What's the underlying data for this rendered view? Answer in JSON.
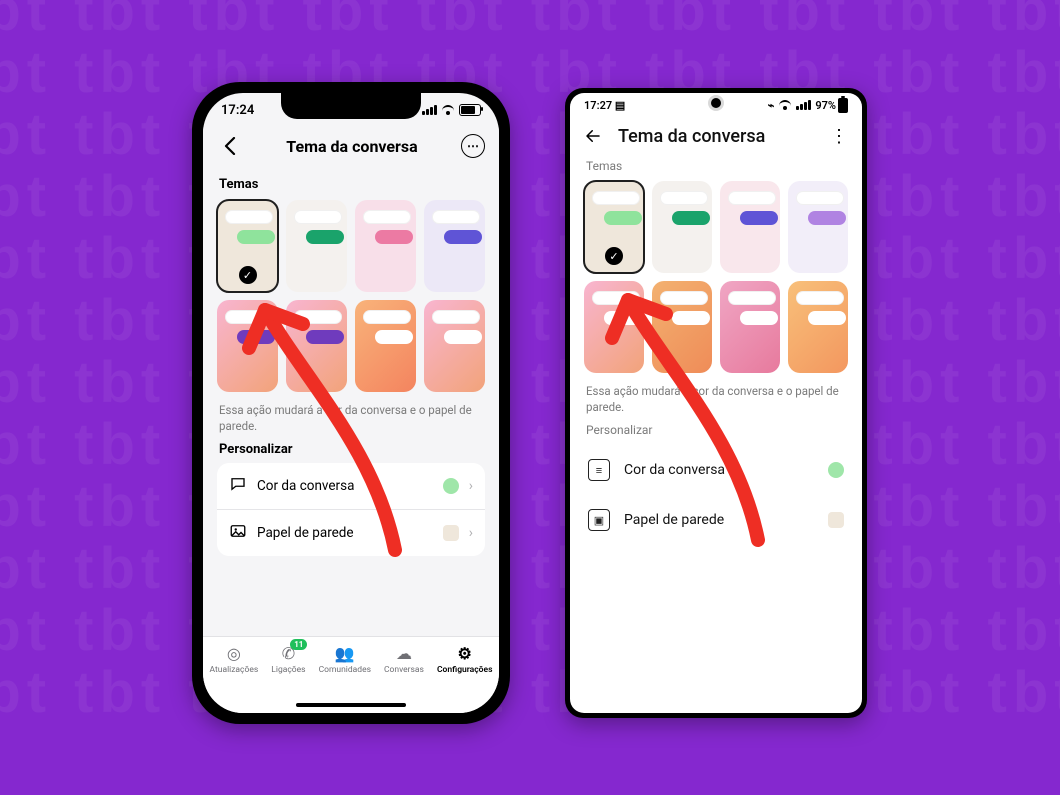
{
  "ios": {
    "status": {
      "time": "17:24"
    },
    "header": {
      "title": "Tema da conversa"
    },
    "sections": {
      "themes": "Temas",
      "customize": "Personalizar"
    },
    "hint": "Essa ação mudará a cor da conversa e o papel de parede.",
    "rows": {
      "chat_color": "Cor da conversa",
      "wallpaper": "Papel de parede"
    },
    "swatches": {
      "chat_color": "#9fe6a9",
      "wallpaper": "#efe7db"
    },
    "tabs": {
      "updates": "Atualizações",
      "calls": "Ligações",
      "calls_badge": "11",
      "communities": "Comunidades",
      "chats": "Conversas",
      "settings": "Configurações"
    }
  },
  "android": {
    "status": {
      "time": "17:27",
      "battery": "97%"
    },
    "header": {
      "title": "Tema da conversa"
    },
    "sections": {
      "themes": "Temas",
      "customize": "Personalizar"
    },
    "hint": "Essa ação mudará a cor da conversa e o papel de parede.",
    "rows": {
      "chat_color": "Cor da conversa",
      "wallpaper": "Papel de parede"
    },
    "swatches": {
      "chat_color": "#9fe6a9",
      "wallpaper": "#efe7db"
    }
  }
}
